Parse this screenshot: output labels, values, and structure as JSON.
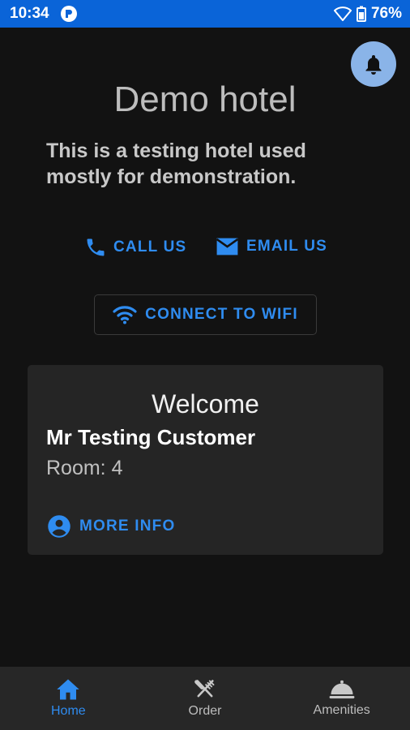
{
  "status_bar": {
    "time": "10:34",
    "battery": "76%",
    "app_badge_letter": "r"
  },
  "hotel": {
    "title": "Demo hotel",
    "description": "This is a testing hotel used mostly for demonstration."
  },
  "actions": {
    "call_label": "CALL US",
    "email_label": "EMAIL US",
    "wifi_label": "CONNECT TO WIFI"
  },
  "card": {
    "welcome": "Welcome",
    "customer_name": "Mr Testing Customer",
    "room": "Room: 4",
    "more_info_label": "MORE INFO"
  },
  "nav": {
    "items": [
      {
        "label": "Home",
        "icon": "home-icon",
        "active": true
      },
      {
        "label": "Order",
        "icon": "utensils-icon",
        "active": false
      },
      {
        "label": "Amenities",
        "icon": "room-service-icon",
        "active": false
      }
    ]
  },
  "colors": {
    "accent": "#2f8cf0",
    "status_bar": "#0a64d8",
    "background": "#121212",
    "card": "#252525",
    "fab": "#8ab4e8"
  }
}
